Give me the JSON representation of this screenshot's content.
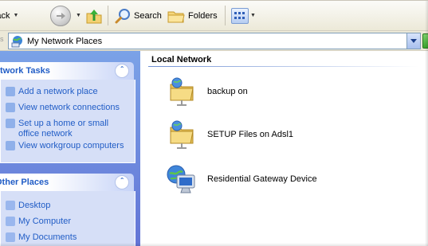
{
  "toolbar": {
    "back_label": "Back",
    "search_label": "Search",
    "folders_label": "Folders"
  },
  "address": {
    "value": "My Network Places"
  },
  "taskpane": {
    "network_tasks": {
      "title": "Network Tasks",
      "items": [
        "Add a network place",
        "View network connections",
        "Set up a home or small office network",
        "View workgroup computers"
      ]
    },
    "other_places": {
      "title": "Other Places",
      "items": [
        "Desktop",
        "My Computer",
        "My Documents"
      ]
    }
  },
  "content": {
    "section_title": "Local Network",
    "items": [
      {
        "label": "backup on",
        "icon": "network-share-folder-icon"
      },
      {
        "label": "SETUP Files on Adsl1",
        "icon": "network-share-folder-icon"
      },
      {
        "label": "Residential Gateway Device",
        "icon": "gateway-device-icon"
      }
    ]
  },
  "colors": {
    "task_link": "#215dc6",
    "task_pane_bg": "#7ba2e7",
    "panel_body_bg": "#d6dff7"
  }
}
